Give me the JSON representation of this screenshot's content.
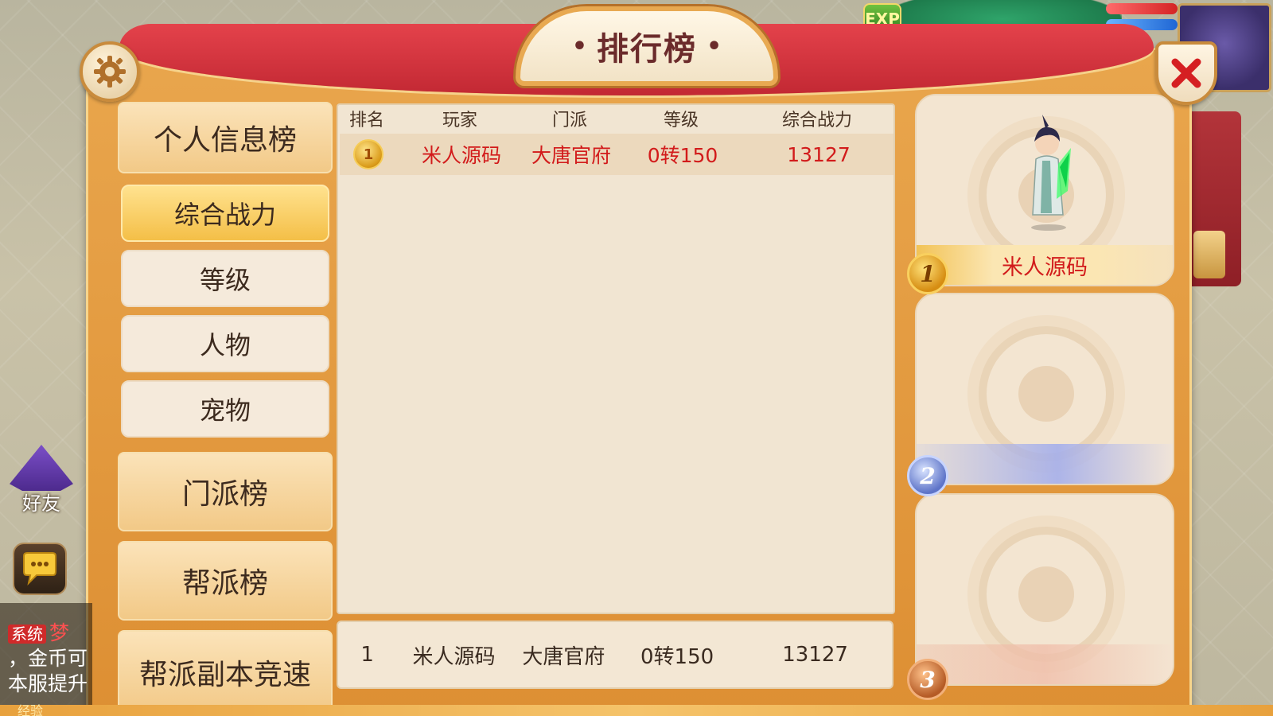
{
  "panel": {
    "title": "排行榜"
  },
  "hud": {
    "exp_badge": "EXP",
    "friends_label": "好友",
    "chat_lines": [
      {
        "tag": "系统",
        "name": "梦"
      },
      {
        "text": "，金币可"
      },
      {
        "text": "本服提升"
      }
    ],
    "exp_label": "经验"
  },
  "categories": {
    "personal": "个人信息榜",
    "sub_items": [
      {
        "label": "综合战力",
        "active": true
      },
      {
        "label": "等级",
        "active": false
      },
      {
        "label": "人物",
        "active": false
      },
      {
        "label": "宠物",
        "active": false
      }
    ],
    "school": "门派榜",
    "guild": "帮派榜",
    "guild_dungeon": "帮派副本竞速"
  },
  "ranking_table": {
    "columns": [
      "排名",
      "玩家",
      "门派",
      "等级",
      "综合战力"
    ],
    "rows": [
      {
        "rank": "1",
        "player": "米人源码",
        "school": "大唐官府",
        "level": "0转150",
        "power": "13127"
      }
    ]
  },
  "my_rank": {
    "rank": "1",
    "player": "米人源码",
    "school": "大唐官府",
    "level": "0转150",
    "power": "13127"
  },
  "podium": [
    {
      "position": "1",
      "name": "米人源码"
    },
    {
      "position": "2",
      "name": ""
    },
    {
      "position": "3",
      "name": ""
    }
  ],
  "colors": {
    "frame": "#e09538",
    "banner_red": "#d6333d",
    "highlight_text": "#d21b1b",
    "active_tab": "#f4bf47"
  }
}
